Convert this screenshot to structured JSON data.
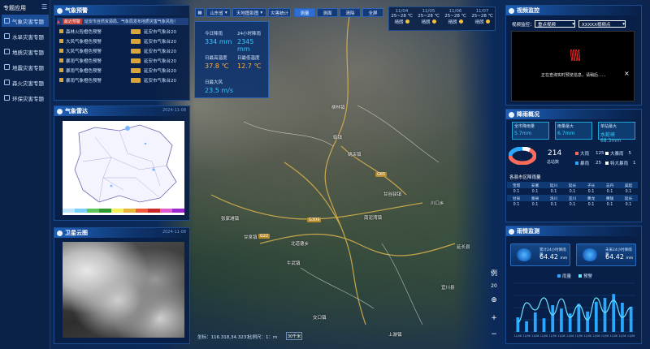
{
  "sidebar": {
    "title": "专题应用",
    "collapse_icon": "collapse-icon",
    "items": [
      {
        "label": "气象灾害专题",
        "active": true
      },
      {
        "label": "水旱灾害专题"
      },
      {
        "label": "地质灾害专题"
      },
      {
        "label": "地震灾害专题"
      },
      {
        "label": "森火灾害专题"
      },
      {
        "label": "环保灾害专题"
      }
    ]
  },
  "warning_panel": {
    "title": "气象预警",
    "banner_tag": "最近预警",
    "banner_text": "延安市自然资源局、气象局发布地质灾害气象风险！",
    "items": [
      {
        "left": "森林火险橙色预警",
        "right": "延安市气象台20"
      },
      {
        "left": "大风气象橙色预警",
        "right": "延安市气象台20"
      },
      {
        "left": "大风气象橙色预警",
        "right": "延安市气象台20"
      },
      {
        "left": "暴雨气象橙色预警",
        "right": "延安市气象台20"
      },
      {
        "left": "暴雨气象橙色预警",
        "right": "延安市气象台20"
      },
      {
        "left": "暴雨气象橙色预警",
        "right": "延安市气象台20"
      }
    ]
  },
  "radar_panel": {
    "title": "气象雷达",
    "date": "2024-11-08"
  },
  "satellite_panel": {
    "title": "卫星云图",
    "date": "2024-11-08"
  },
  "toolbar": {
    "region": "山东省",
    "map_type": "天地图影图",
    "stats": "灾害统计",
    "tabs": [
      "测量",
      "测面",
      "清除",
      "全屏"
    ],
    "selected_tab": "测量"
  },
  "forecast": [
    {
      "date": "11/04",
      "temp": "25~28 ℃",
      "weather": "晴朗"
    },
    {
      "date": "11/05",
      "temp": "25~28 ℃",
      "weather": "晴朗"
    },
    {
      "date": "11/06",
      "temp": "25~28 ℃",
      "weather": "晴朗"
    },
    {
      "date": "11/07",
      "temp": "25~28 ℃",
      "weather": "晴朗"
    }
  ],
  "stats_box": {
    "today_rain_label": "今日降雨",
    "today_rain_value": "334 mm",
    "rain24_label": "24小时降雨",
    "rain24_value": "2345 mm",
    "max_temp_label": "日最高温度",
    "max_temp_value": "37.8 ℃",
    "min_temp_label": "日最低温度",
    "min_temp_value": "12.7 ℃",
    "wind_label": "日最大风",
    "wind_value": "23.5 m/s"
  },
  "map_labels": [
    {
      "text": "柳林镇"
    },
    {
      "text": "临镇"
    },
    {
      "text": "姚店镇"
    },
    {
      "text": "甘谷驿镇"
    },
    {
      "text": "张家滩镇"
    },
    {
      "text": "甘泉镇"
    },
    {
      "text": "北道德乡"
    },
    {
      "text": "川口乡"
    },
    {
      "text": "延长县"
    },
    {
      "text": "牛武镇"
    },
    {
      "text": "南泥湾镇"
    },
    {
      "text": "宜川县"
    },
    {
      "text": "交口镇"
    },
    {
      "text": "上游镇"
    }
  ],
  "road_labels": [
    "G309",
    "G22",
    "G65"
  ],
  "status_bar": {
    "coords": "坐标：116.318,34.3237",
    "scale": "比例尺：1：m",
    "scale_btn": "30千米"
  },
  "map_tools": {
    "legend": "例",
    "zoom_level": "20",
    "locate_icon": "locate-icon",
    "zoom_in": "+",
    "zoom_out": "−"
  },
  "video_panel": {
    "title": "视频监控",
    "filter_label": "视频监控：",
    "filter_value": "重点视频",
    "camera_value": "XXXXX视频点",
    "status_text": "正在查询实时预览信息，请稍后......",
    "close_icon": "×"
  },
  "rainfall_overview": {
    "title": "降雨概况",
    "boxes": [
      {
        "label": "全市降雨量",
        "value": "5.7mm"
      },
      {
        "label": "雨量最大",
        "value": "6.7mm"
      },
      {
        "label": "单站最大",
        "value": "水蛇峡 68.3mm"
      }
    ],
    "total_value": "214",
    "total_label": "总站数",
    "legend": [
      {
        "label": "大雨",
        "value": "125",
        "color": "#ff6b5a"
      },
      {
        "label": "大暴雨",
        "value": "5",
        "color": "#ffffff"
      },
      {
        "label": "暴雨",
        "value": "25",
        "color": "#2aa7ff"
      },
      {
        "label": "特大暴雨",
        "value": "1",
        "color": "#ffffff"
      }
    ],
    "table_title": "各县市区降雨量",
    "table": {
      "row1_headers": [
        "宝塔",
        "安塞",
        "延川",
        "延长",
        "子长",
        "志丹",
        "吴起"
      ],
      "row1_values": [
        "0.1",
        "0.1",
        "0.1",
        "0.1",
        "0.1",
        "0.1",
        "0.1"
      ],
      "row2_headers": [
        "甘泉",
        "富县",
        "洛川",
        "宜川",
        "黄龙",
        "黄陵",
        "延长"
      ],
      "row2_values": [
        "0.1",
        "0.1",
        "0.1",
        "0.1",
        "0.1",
        "0.1",
        "0.1"
      ]
    }
  },
  "rain_monitor": {
    "title": "雨情监测",
    "card1_label": "累计24小时降雨量",
    "card1_value": "64.42",
    "card1_unit": "mm",
    "card2_label": "未来24小时降雨量",
    "card2_value": "64.42",
    "card2_unit": "mm",
    "legend": [
      "雨量",
      "预警"
    ]
  },
  "chart_data": {
    "type": "bar",
    "categories": [
      "11/06",
      "11/06",
      "11/06",
      "11/06",
      "11/06",
      "11/06",
      "11/06",
      "11/06",
      "11/06",
      "11/06",
      "11/06",
      "11/06",
      "11/06",
      "11/06"
    ],
    "series": [
      {
        "name": "雨量",
        "values": [
          30,
          22,
          40,
          28,
          55,
          48,
          38,
          58,
          42,
          62,
          70,
          78,
          60,
          52
        ]
      },
      {
        "name": "预警",
        "values": [
          20,
          60,
          45,
          70,
          35,
          68,
          30,
          55,
          25,
          70,
          40,
          65,
          30,
          50
        ]
      }
    ],
    "ylim": [
      0,
      100
    ]
  }
}
